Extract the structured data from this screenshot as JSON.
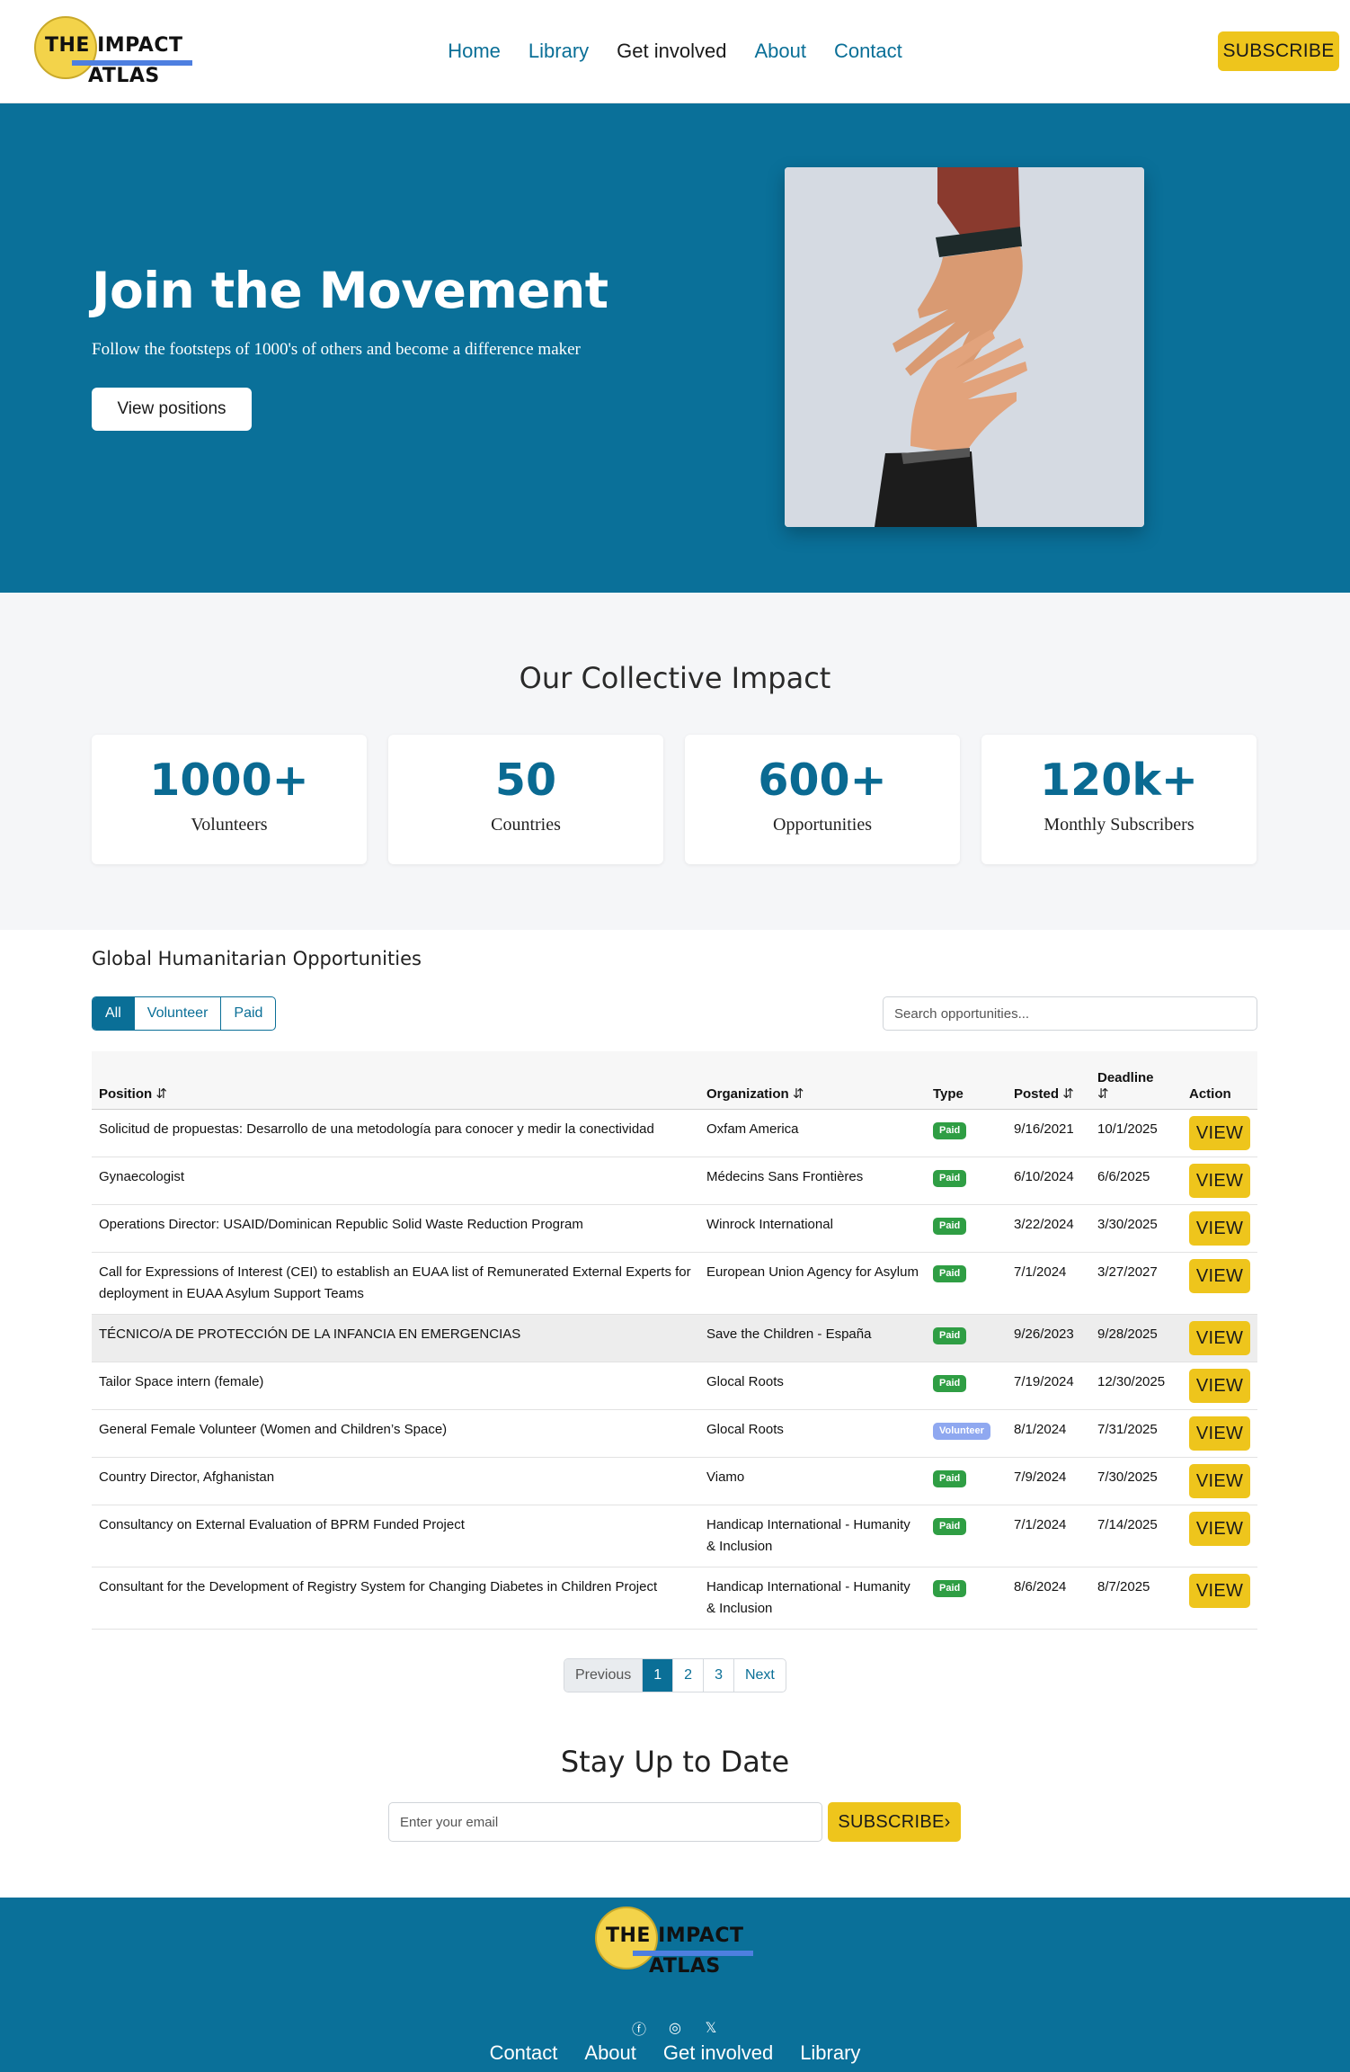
{
  "brand": {
    "line1": "THE IMPACT",
    "line2": "ATLAS"
  },
  "nav": {
    "items": [
      {
        "label": "Home",
        "active": false
      },
      {
        "label": "Library",
        "active": false
      },
      {
        "label": "Get involved",
        "active": true
      },
      {
        "label": "About",
        "active": false
      },
      {
        "label": "Contact",
        "active": false
      }
    ],
    "subscribe_label": "SUBSCRIBE"
  },
  "hero": {
    "title": "Join the Movement",
    "subtitle": "Follow the footsteps of 1000's of others and become a difference maker",
    "button_label": "View positions"
  },
  "impact": {
    "title": "Our Collective Impact",
    "stats": [
      {
        "value": "1000+",
        "label": "Volunteers"
      },
      {
        "value": "50",
        "label": "Countries"
      },
      {
        "value": "600+",
        "label": "Opportunities"
      },
      {
        "value": "120k+",
        "label": "Monthly Subscribers"
      }
    ]
  },
  "opportunities": {
    "title": "Global Humanitarian Opportunities",
    "filters": [
      "All",
      "Volunteer",
      "Paid"
    ],
    "active_filter": "All",
    "search_placeholder": "Search opportunities...",
    "columns": {
      "position": "Position",
      "organization": "Organization",
      "type": "Type",
      "posted": "Posted",
      "deadline": "Deadline",
      "action": "Action"
    },
    "sort_icon": "⇵",
    "action_label": "VIEW",
    "rows": [
      {
        "position": "Solicitud de propuestas: Desarrollo de una metodología para conocer y medir la conectividad",
        "organization": "Oxfam America",
        "type": "Paid",
        "posted": "9/16/2021",
        "deadline": "10/1/2025"
      },
      {
        "position": "Gynaecologist",
        "organization": "Médecins Sans Frontières",
        "type": "Paid",
        "posted": "6/10/2024",
        "deadline": "6/6/2025"
      },
      {
        "position": "Operations Director: USAID/Dominican Republic Solid Waste Reduction Program",
        "organization": "Winrock International",
        "type": "Paid",
        "posted": "3/22/2024",
        "deadline": "3/30/2025"
      },
      {
        "position": "Call for Expressions of Interest (CEI) to establish an EUAA list of Remunerated External Experts for deployment in EUAA Asylum Support Teams",
        "organization": "European Union Agency for Asylum",
        "type": "Paid",
        "posted": "7/1/2024",
        "deadline": "3/27/2027"
      },
      {
        "position": "TÉCNICO/A DE PROTECCIÓN DE LA INFANCIA EN EMERGENCIAS",
        "organization": "Save the Children - España",
        "type": "Paid",
        "posted": "9/26/2023",
        "deadline": "9/28/2025"
      },
      {
        "position": "Tailor Space intern (female)",
        "organization": "Glocal Roots",
        "type": "Paid",
        "posted": "7/19/2024",
        "deadline": "12/30/2025"
      },
      {
        "position": "General Female Volunteer (Women and Children’s Space)",
        "organization": "Glocal Roots",
        "type": "Volunteer",
        "posted": "8/1/2024",
        "deadline": "7/31/2025"
      },
      {
        "position": "Country Director, Afghanistan",
        "organization": "Viamo",
        "type": "Paid",
        "posted": "7/9/2024",
        "deadline": "7/30/2025"
      },
      {
        "position": "Consultancy on External Evaluation of BPRM Funded Project",
        "organization": "Handicap International - Humanity & Inclusion",
        "type": "Paid",
        "posted": "7/1/2024",
        "deadline": "7/14/2025"
      },
      {
        "position": "Consultant for the Development of Registry System for Changing Diabetes in Children Project",
        "organization": "Handicap International - Humanity & Inclusion",
        "type": "Paid",
        "posted": "8/6/2024",
        "deadline": "8/7/2025"
      }
    ],
    "pagination": {
      "previous": "Previous",
      "pages": [
        "1",
        "2",
        "3"
      ],
      "current": "1",
      "next": "Next"
    }
  },
  "newsletter": {
    "title": "Stay Up to Date",
    "email_placeholder": "Enter your email",
    "button_label": "SUBSCRIBE",
    "button_icon": "›"
  },
  "footer": {
    "social": [
      {
        "icon": "facebook-icon",
        "glyph": "ⓕ"
      },
      {
        "icon": "instagram-icon",
        "glyph": "◎"
      },
      {
        "icon": "x-twitter-icon",
        "glyph": "𝕏"
      }
    ],
    "links": [
      "Contact",
      "About",
      "Get involved",
      "Library"
    ]
  },
  "colors": {
    "primary": "#0a7099",
    "accent": "#eec51c",
    "paid_badge": "#2f9e44",
    "volunteer_badge": "#8fa8f0"
  }
}
